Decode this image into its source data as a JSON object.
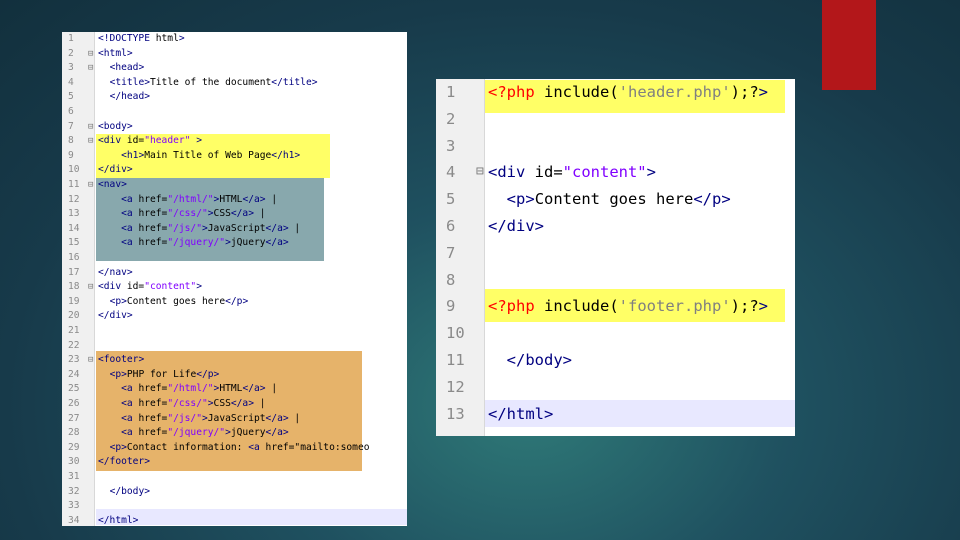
{
  "colors": {
    "accent": "#b3171a",
    "highlight_yellow": "#ffff66",
    "highlight_teal": "#88a8ad",
    "highlight_orange": "#e6b36a",
    "current_line": "#e8e8ff"
  },
  "left_editor": {
    "lines": [
      {
        "n": "1",
        "code": "<!DOCTYPE html>"
      },
      {
        "n": "2",
        "code": "<html>"
      },
      {
        "n": "3",
        "code": "  <head>"
      },
      {
        "n": "4",
        "code": "  <title>Title of the document</title>"
      },
      {
        "n": "5",
        "code": "  </head>"
      },
      {
        "n": "6",
        "code": ""
      },
      {
        "n": "7",
        "code": "<body>"
      },
      {
        "n": "8",
        "code": "<div id=\"header\" >"
      },
      {
        "n": "9",
        "code": "    <h1>Main Title of Web Page</h1>"
      },
      {
        "n": "10",
        "code": "</div>"
      },
      {
        "n": "11",
        "code": "<nav>"
      },
      {
        "n": "12",
        "code": "    <a href=\"/html/\">HTML</a> |"
      },
      {
        "n": "13",
        "code": "    <a href=\"/css/\">CSS</a> |"
      },
      {
        "n": "14",
        "code": "    <a href=\"/js/\">JavaScript</a> |"
      },
      {
        "n": "15",
        "code": "    <a href=\"/jquery/\">jQuery</a>"
      },
      {
        "n": "16",
        "code": ""
      },
      {
        "n": "17",
        "code": "</nav>"
      },
      {
        "n": "18",
        "code": "<div id=\"content\">"
      },
      {
        "n": "19",
        "code": "  <p>Content goes here</p>"
      },
      {
        "n": "20",
        "code": "</div>"
      },
      {
        "n": "21",
        "code": ""
      },
      {
        "n": "22",
        "code": ""
      },
      {
        "n": "23",
        "code": "<footer>"
      },
      {
        "n": "24",
        "code": "  <p>PHP for Life</p>"
      },
      {
        "n": "25",
        "code": "    <a href=\"/html/\">HTML</a> |"
      },
      {
        "n": "26",
        "code": "    <a href=\"/css/\">CSS</a> |"
      },
      {
        "n": "27",
        "code": "    <a href=\"/js/\">JavaScript</a> |"
      },
      {
        "n": "28",
        "code": "    <a href=\"/jquery/\">jQuery</a>"
      },
      {
        "n": "29",
        "code": "  <p>Contact information: <a href=\"mailto:someo"
      },
      {
        "n": "30",
        "code": "</footer>"
      },
      {
        "n": "31",
        "code": ""
      },
      {
        "n": "32",
        "code": "  </body>"
      },
      {
        "n": "33",
        "code": ""
      },
      {
        "n": "34",
        "code": "</html>"
      }
    ]
  },
  "right_editor": {
    "lines": [
      {
        "n": "1",
        "code": "<?php include('header.php');?>"
      },
      {
        "n": "2",
        "code": ""
      },
      {
        "n": "3",
        "code": ""
      },
      {
        "n": "4",
        "code": "<div id=\"content\">"
      },
      {
        "n": "5",
        "code": "  <p>Content goes here</p>"
      },
      {
        "n": "6",
        "code": "</div>"
      },
      {
        "n": "7",
        "code": ""
      },
      {
        "n": "8",
        "code": ""
      },
      {
        "n": "9",
        "code": "<?php include('footer.php');?>"
      },
      {
        "n": "10",
        "code": ""
      },
      {
        "n": "11",
        "code": "  </body>"
      },
      {
        "n": "12",
        "code": ""
      },
      {
        "n": "13",
        "code": "</html>"
      }
    ]
  }
}
